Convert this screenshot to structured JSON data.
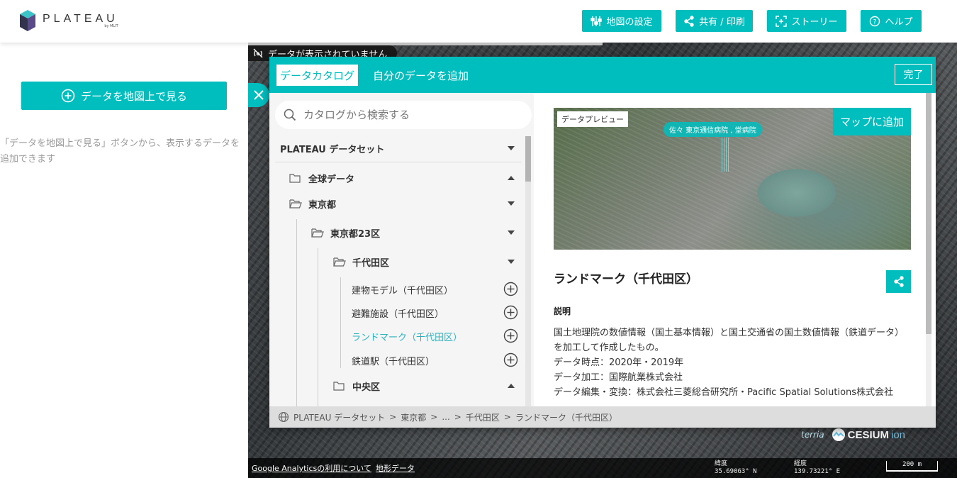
{
  "header": {
    "logo_main": "PLATEAU",
    "logo_sub": "by MLIT",
    "buttons": {
      "map_settings": "地図の設定",
      "share_print": "共有 / 印刷",
      "story": "ストーリー",
      "help": "ヘルプ"
    }
  },
  "left_panel": {
    "view_data_button": "データを地図上で見る",
    "hint": "「データを地図上で見る」ボタンから、表示するデータを追加できます"
  },
  "map": {
    "notice": "データが表示されていません",
    "credits": {
      "terria": "terria",
      "cesium": "CESIUM",
      "ion": "ion"
    },
    "bottom_links": [
      "Google Analyticsの利用について",
      "地形データ"
    ],
    "latitude_label": "緯度",
    "latitude_value": "35.69063° N",
    "longitude_label": "経度",
    "longitude_value": "139.73221° E",
    "scale": "200 m"
  },
  "catalog": {
    "tabs": {
      "active": "データカタログ",
      "other": "自分のデータを追加"
    },
    "done_button": "完了",
    "search_placeholder": "カタログから検索する",
    "dataset_group": "PLATEAU データセット",
    "tree": {
      "global": "全球データ",
      "tokyo": "東京都",
      "tokyo23": "東京都23区",
      "chiyoda": "千代田区",
      "items": [
        "建物モデル（千代田区）",
        "避難施設（千代田区）",
        "ランドマーク（千代田区）",
        "鉄道駅（千代田区）"
      ],
      "selected_item": "ランドマーク（千代田区）",
      "chuo": "中央区"
    },
    "preview": {
      "label": "データプレビュー",
      "add_to_map": "マップに追加",
      "pin_text": "佐々 東京通信病院 , 堂病院"
    },
    "detail": {
      "title": "ランドマーク（千代田区）",
      "description_heading": "説明",
      "description_lines": [
        "国土地理院の数値情報（国土基本情報）と国土交通省の国土数値情報（鉄道データ）を加工して作成したもの。",
        "データ時点：2020年・2019年",
        "データ加工：国際航業株式会社",
        "データ編集・変換：株式会社三菱総合研究所・Pacific Spatial Solutions株式会社"
      ]
    },
    "breadcrumb": [
      "PLATEAU データセット",
      "東京都",
      "...",
      "千代田区",
      "ランドマーク（千代田区）"
    ]
  },
  "colors": {
    "accent": "#00bebe",
    "selected_text": "#2ab3c0"
  }
}
